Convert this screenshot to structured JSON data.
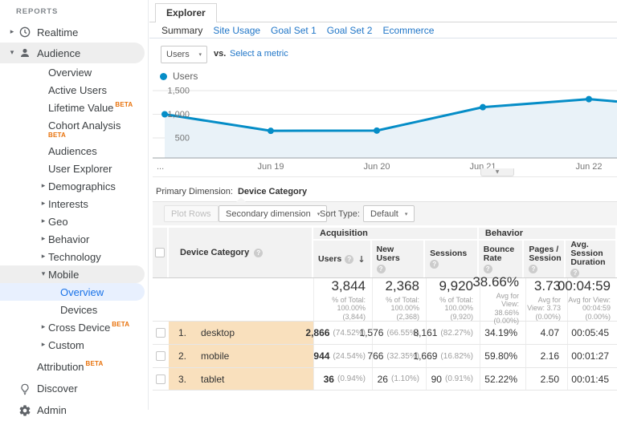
{
  "colors": {
    "chart_blue": "#058dc7",
    "link_blue": "#2076c8",
    "selected_blue": "#1a73e8",
    "beta_orange": "#e8710a",
    "row_highlight_orange": "#f9e0bd",
    "header_grey": "#f2f2f2"
  },
  "sidebar": {
    "section_label": "REPORTS",
    "items": [
      {
        "label": "Realtime",
        "icon": "clock-icon",
        "arrow": "collapsed",
        "indent": 0
      },
      {
        "label": "Audience",
        "icon": "person-icon",
        "arrow": "expanded",
        "indent": 0,
        "highlight": "grey"
      },
      {
        "label": "Overview",
        "indent": 1
      },
      {
        "label": "Active Users",
        "indent": 1
      },
      {
        "label": "Lifetime Value",
        "beta": "inline",
        "indent": 1
      },
      {
        "label": "Cohort Analysis",
        "beta": "below",
        "indent": 1
      },
      {
        "label": "Audiences",
        "indent": 1
      },
      {
        "label": "User Explorer",
        "indent": 1
      },
      {
        "label": "Demographics",
        "arrow": "collapsed",
        "indent": 1
      },
      {
        "label": "Interests",
        "arrow": "collapsed",
        "indent": 1
      },
      {
        "label": "Geo",
        "arrow": "collapsed",
        "indent": 1
      },
      {
        "label": "Behavior",
        "arrow": "collapsed",
        "indent": 1
      },
      {
        "label": "Technology",
        "arrow": "collapsed",
        "indent": 1
      },
      {
        "label": "Mobile",
        "arrow": "expanded",
        "indent": 1,
        "highlight": "grey"
      },
      {
        "label": "Overview",
        "indent": 2,
        "highlight": "blue"
      },
      {
        "label": "Devices",
        "indent": 2
      },
      {
        "label": "Cross Device",
        "beta": "inline",
        "arrow": "collapsed",
        "indent": 1
      },
      {
        "label": "Custom",
        "arrow": "collapsed",
        "indent": 1
      },
      {
        "label": "Attribution",
        "beta": "inline",
        "indent": 0,
        "footer": true,
        "gap_before": true
      },
      {
        "label": "Discover",
        "icon": "lightbulb-icon",
        "indent": 0,
        "footer": true
      },
      {
        "label": "Admin",
        "icon": "gear-icon",
        "indent": 0,
        "footer": true
      }
    ]
  },
  "tabs": {
    "explorer": "Explorer",
    "sub": [
      {
        "label": "Summary",
        "active": true
      },
      {
        "label": "Site Usage",
        "active": false
      },
      {
        "label": "Goal Set 1",
        "active": false
      },
      {
        "label": "Goal Set 2",
        "active": false
      },
      {
        "label": "Ecommerce",
        "active": false
      }
    ]
  },
  "metric_bar": {
    "metric_selector": "Users",
    "dropdown_icon": "chevron-down-icon",
    "vs": "vs.",
    "select_link": "Select a metric",
    "legend": "Users"
  },
  "chart_data": {
    "type": "line",
    "title": "Users",
    "x_axis_labels": [
      "...",
      "Jun 19",
      "Jun 20",
      "Jun 21",
      "Jun 22"
    ],
    "y_ticks": [
      500,
      1000,
      1500
    ],
    "y_tick_labels": [
      "500",
      "1,000",
      "1,500"
    ],
    "ylim": [
      0,
      1600
    ],
    "grid": true,
    "legend_position": "top-left",
    "series": [
      {
        "name": "Users",
        "color": "#058dc7",
        "points": [
          {
            "x": "Jun 18",
            "value": 1000
          },
          {
            "x": "Jun 19",
            "value": 650
          },
          {
            "x": "Jun 20",
            "value": 655
          },
          {
            "x": "Jun 21",
            "value": 1150
          },
          {
            "x": "Jun 22",
            "value": 1320
          },
          {
            "x": "right-edge",
            "value": 1270
          }
        ]
      }
    ]
  },
  "primary_dimension": {
    "label": "Primary Dimension:",
    "value": "Device Category"
  },
  "toolbar": {
    "plot_rows": "Plot Rows",
    "secondary_dimension": "Secondary dimension",
    "sort_type_label": "Sort Type:",
    "sort_type_value": "Default"
  },
  "table": {
    "groups": [
      {
        "label": "Acquisition",
        "span": [
          "Users",
          "New Users",
          "Sessions"
        ]
      },
      {
        "label": "Behavior",
        "span": [
          "Bounce Rate",
          "Pages / Session",
          "Avg. Session Duration"
        ]
      }
    ],
    "dimension_column": "Device Category",
    "metric_columns": [
      "Users",
      "New Users",
      "Sessions",
      "Bounce Rate",
      "Pages / Session",
      "Avg. Session Duration"
    ],
    "sorted_column": "Users",
    "totals": [
      {
        "value": "3,844",
        "note": [
          "% of Total:",
          "100.00% (3,844)"
        ]
      },
      {
        "value": "2,368",
        "note": [
          "% of Total:",
          "100.00% (2,368)"
        ]
      },
      {
        "value": "9,920",
        "note": [
          "% of Total:",
          "100.00% (9,920)"
        ]
      },
      {
        "value": "38.66%",
        "note": [
          "Avg for View:",
          "38.66%",
          "(0.00%)"
        ]
      },
      {
        "value": "3.73",
        "note": [
          "Avg for",
          "View: 3.73",
          "(0.00%)"
        ]
      },
      {
        "value": "00:04:59",
        "note": [
          "Avg for View:",
          "00:04:59",
          "(0.00%)"
        ]
      }
    ],
    "rows": [
      {
        "rank": "1.",
        "device": "desktop",
        "users": "2,866",
        "users_pct": "(74.52%)",
        "new_users": "1,576",
        "new_users_pct": "(66.55%)",
        "sessions": "8,161",
        "sessions_pct": "(82.27%)",
        "bounce_rate": "34.19%",
        "pages_session": "4.07",
        "avg_duration": "00:05:45"
      },
      {
        "rank": "2.",
        "device": "mobile",
        "users": "944",
        "users_pct": "(24.54%)",
        "new_users": "766",
        "new_users_pct": "(32.35%)",
        "sessions": "1,669",
        "sessions_pct": "(16.82%)",
        "bounce_rate": "59.80%",
        "pages_session": "2.16",
        "avg_duration": "00:01:27"
      },
      {
        "rank": "3.",
        "device": "tablet",
        "users": "36",
        "users_pct": "(0.94%)",
        "new_users": "26",
        "new_users_pct": "(1.10%)",
        "sessions": "90",
        "sessions_pct": "(0.91%)",
        "bounce_rate": "52.22%",
        "pages_session": "2.50",
        "avg_duration": "00:01:45"
      }
    ]
  }
}
